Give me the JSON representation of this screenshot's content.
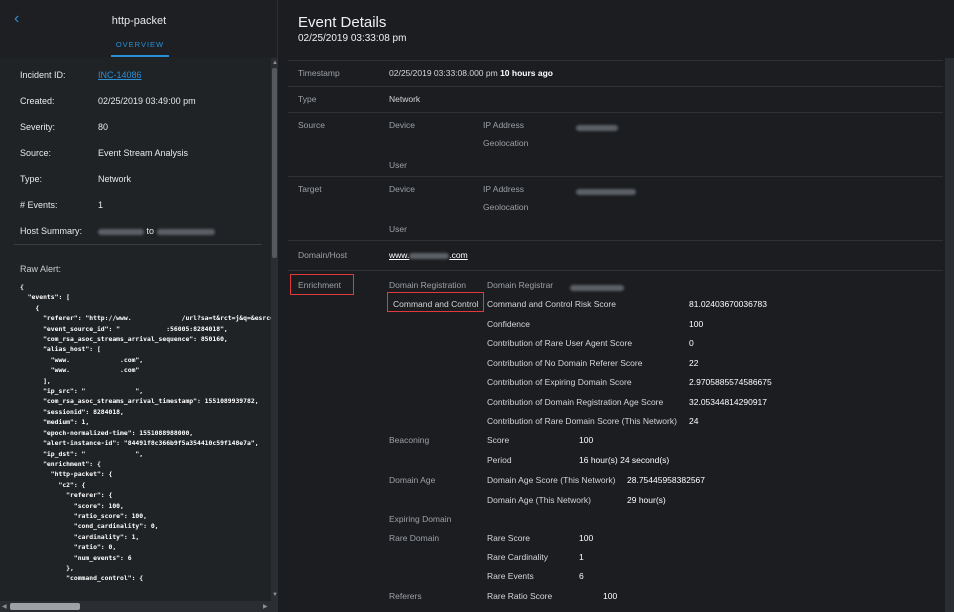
{
  "left_panel": {
    "title": "http-packet",
    "tab": "OVERVIEW",
    "incident_id_label": "Incident ID:",
    "incident_id": "INC-14086",
    "created_label": "Created:",
    "created": "02/25/2019 03:49:00 pm",
    "severity_label": "Severity:",
    "severity": "80",
    "source_label": "Source:",
    "source": "Event Stream Analysis",
    "type_label": "Type:",
    "type": "Network",
    "events_label": "# Events:",
    "events": "1",
    "host_summary_label": "Host Summary:",
    "host_summary_to": "to",
    "raw_alert_label": "Raw Alert:",
    "raw_alert_lines": [
      "{",
      "  \"events\": [",
      "    {",
      "      \"referer\": \"http://www.             /url?sa=t&rct=j&q=&esrc=s",
      "      \"event_source_id\": \"            :56005:8284018\",",
      "      \"com_rsa_asoc_streams_arrival_sequence\": 850160,",
      "      \"alias_host\": [",
      "        \"www.             .com\",",
      "        \"www.             .com\"",
      "      ],",
      "      \"ip_src\": \"             \",",
      "      \"com_rsa_asoc_streams_arrival_timestamp\": 1551089939782,",
      "      \"sessionid\": 8284018,",
      "      \"medium\": 1,",
      "      \"epoch-normalized-time\": 1551088988000,",
      "      \"alert-instance-id\": \"84491f8c366b9f5a354410c59f148e7a\",",
      "      \"ip_dst\": \"             \",",
      "      \"enrichment\": {",
      "        \"http-packet\": {",
      "          \"c2\": {",
      "            \"referer\": {",
      "              \"score\": 100,",
      "              \"ratio_score\": 100,",
      "              \"cond_cardinality\": 0,",
      "              \"cardinality\": 1,",
      "              \"ratio\": 0,",
      "              \"num_events\": 6",
      "            },",
      "            \"command_control\": {"
    ]
  },
  "event_details": {
    "title": "Event Details",
    "subtitle": "02/25/2019 03:33:08 pm",
    "timestamp_label": "Timestamp",
    "timestamp": "02/25/2019 03:33:08.000 pm",
    "timestamp_relative": "10 hours ago",
    "type_label": "Type",
    "type": "Network",
    "source_label": "Source",
    "target_label": "Target",
    "device_label": "Device",
    "user_label": "User",
    "ip_address_label": "IP Address",
    "geolocation_label": "Geolocation",
    "domain_host_label": "Domain/Host",
    "domain_prefix": "www.",
    "domain_suffix": ".com",
    "enrichment_label": "Enrichment",
    "domain_registration_label": "Domain Registration",
    "domain_registrar_label": "Domain Registrar",
    "command_control_label": "Command and Control",
    "cc_rows": [
      {
        "label": "Command and Control Risk Score",
        "value": "81.02403670036783"
      },
      {
        "label": "Confidence",
        "value": "100"
      },
      {
        "label": "Contribution of Rare User Agent Score",
        "value": "0"
      },
      {
        "label": "Contribution of No Domain Referer Score",
        "value": "22"
      },
      {
        "label": "Contribution of Expiring Domain Score",
        "value": "2.9705885574586675"
      },
      {
        "label": "Contribution of Domain Registration Age Score",
        "value": "32.05344814290917"
      },
      {
        "label": "Contribution of Rare Domain Score (This Network)",
        "value": "24"
      }
    ],
    "beaconing_label": "Beaconing",
    "beaconing_rows": [
      {
        "label": "Score",
        "value": "100"
      },
      {
        "label": "Period",
        "value": "16 hour(s) 24 second(s)"
      }
    ],
    "domain_age_label": "Domain Age",
    "domain_age_rows": [
      {
        "label": "Domain Age Score (This Network)",
        "value": "28.75445958382567"
      },
      {
        "label": "Domain Age (This Network)",
        "value": "29 hour(s)"
      }
    ],
    "expiring_domain_label": "Expiring Domain",
    "rare_domain_label": "Rare Domain",
    "rare_domain_rows": [
      {
        "label": "Rare Score",
        "value": "100"
      },
      {
        "label": "Rare Cardinality",
        "value": "1"
      },
      {
        "label": "Rare Events",
        "value": "6"
      }
    ],
    "referers_label": "Referers",
    "referers_rows": [
      {
        "label": "Rare Ratio Score",
        "value": "100"
      }
    ]
  },
  "colors": {
    "accent": "#2b8fd6",
    "highlight_box": "#e0393e",
    "background": "#1b1d20"
  }
}
